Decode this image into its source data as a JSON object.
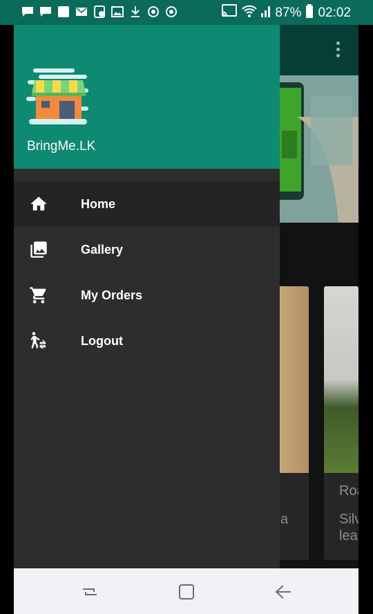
{
  "status": {
    "battery": "87%",
    "time": "02:02",
    "icons": [
      "chat-icon",
      "chat-icon",
      "square-icon",
      "mail-icon",
      "alarm-icon",
      "image-icon",
      "download-icon",
      "sync-icon",
      "sync-icon",
      "cast-icon",
      "wifi-icon",
      "signal-icon",
      "battery-icon"
    ]
  },
  "drawer": {
    "brand": "BringMe.LK",
    "items": [
      {
        "label": "Home",
        "icon": "home-icon",
        "active": true
      },
      {
        "label": "Gallery",
        "icon": "gallery-icon"
      },
      {
        "label": "My Orders",
        "icon": "cart-icon"
      },
      {
        "label": "Logout",
        "icon": "logout-icon"
      }
    ]
  },
  "background_app": {
    "card1_text": "a",
    "card2_title": "Roa",
    "card2_sub_1": "Silv",
    "card2_sub_2": "lea"
  },
  "navbar": {
    "icons": [
      "recents-icon",
      "home-button-icon",
      "back-icon"
    ]
  },
  "colors": {
    "accent": "#0e8a73",
    "drawer_bg": "#2d2d2d"
  }
}
